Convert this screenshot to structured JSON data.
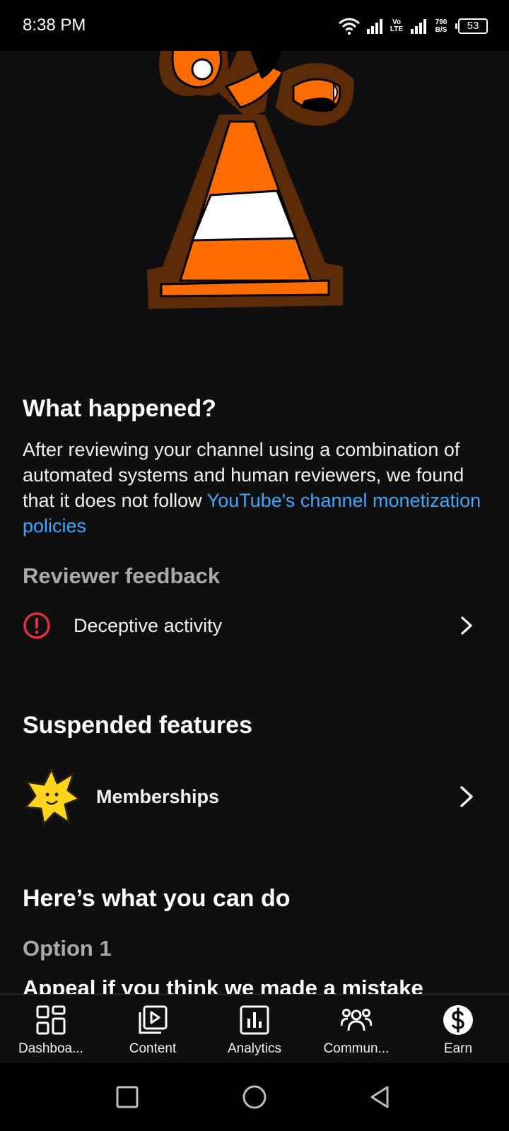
{
  "status_bar": {
    "time": "8:38 PM",
    "volte_top": "Vo",
    "volte_bottom": "LTE",
    "speed_value": "790",
    "speed_unit": "B/S",
    "battery": "53"
  },
  "violation": {
    "what_happened_title": "What happened?",
    "body_text": "After reviewing your channel using a combination of automated systems and human reviewers, we found that it does not follow ",
    "policy_link": "YouTube's channel monetization policies",
    "reviewer_feedback_title": "Reviewer feedback",
    "feedback_item": "Deceptive activity"
  },
  "suspended": {
    "title": "Suspended features",
    "item": "Memberships"
  },
  "what_you_can_do": {
    "title": "Here’s what you can do",
    "option_label": "Option 1",
    "option_title": "Appeal if you think we made a mistake"
  },
  "bottom_nav": {
    "items": [
      {
        "label": "Dashboa...",
        "icon": "dashboard-icon"
      },
      {
        "label": "Content",
        "icon": "content-icon"
      },
      {
        "label": "Analytics",
        "icon": "analytics-icon"
      },
      {
        "label": "Commun...",
        "icon": "community-icon"
      },
      {
        "label": "Earn",
        "icon": "earn-icon"
      }
    ]
  },
  "colors": {
    "background": "#0f0f0f",
    "link": "#3ea6ff",
    "alert": "#e0303a",
    "cone_orange": "#ff6d00",
    "cone_outline": "#5c2b07"
  }
}
